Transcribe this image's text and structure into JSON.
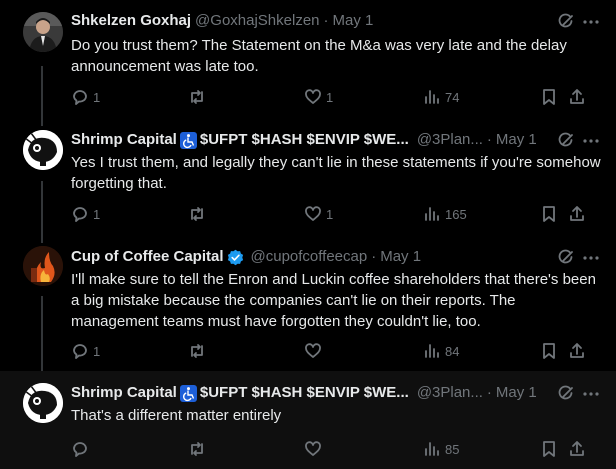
{
  "tweets": [
    {
      "name": "Shkelzen Goxhaj",
      "emoji": "",
      "handle": "@GoxhajShkelzen",
      "date": "May 1",
      "verified": false,
      "text": "Do you trust them? The Statement on the M&a was very late and the delay announcement was late too.",
      "replies": "1",
      "reposts": "",
      "likes": "1",
      "views": "74"
    },
    {
      "name": "Shrimp Capital",
      "emoji": "♿",
      "name_rest": "$UFPT $HASH $ENVIP $WE...",
      "handle": "@3Plan...",
      "date": "May 1",
      "verified": false,
      "text": "Yes I trust them, and legally they can't lie in these statements if you're somehow forgetting that.",
      "replies": "1",
      "reposts": "",
      "likes": "1",
      "views": "165"
    },
    {
      "name": "Cup of Coffee Capital",
      "emoji": "",
      "handle": "@cupofcoffeecap",
      "date": "May 1",
      "verified": true,
      "text": "I'll make sure to tell the Enron and Luckin coffee shareholders that there's been a big mistake because the companies can't lie on their reports. The management teams must have forgotten they couldn't lie, too.",
      "replies": "1",
      "reposts": "",
      "likes": "",
      "views": "84"
    },
    {
      "name": "Shrimp Capital",
      "emoji": "♿",
      "name_rest": "$UFPT $HASH $ENVIP $WE...",
      "handle": "@3Plan...",
      "date": "May 1",
      "verified": false,
      "text": "That's a different matter entirely",
      "replies": "",
      "reposts": "",
      "likes": "",
      "views": "85"
    }
  ],
  "icons": [
    "grok-icon",
    "more-icon",
    "reply-icon",
    "repost-icon",
    "like-icon",
    "views-icon",
    "bookmark-icon",
    "share-icon"
  ],
  "colors": {
    "background": "#000000",
    "text": "#e7e9ea",
    "muted": "#71767b",
    "verified": "#1d9bf0",
    "highlight": "#0f0f0f"
  }
}
